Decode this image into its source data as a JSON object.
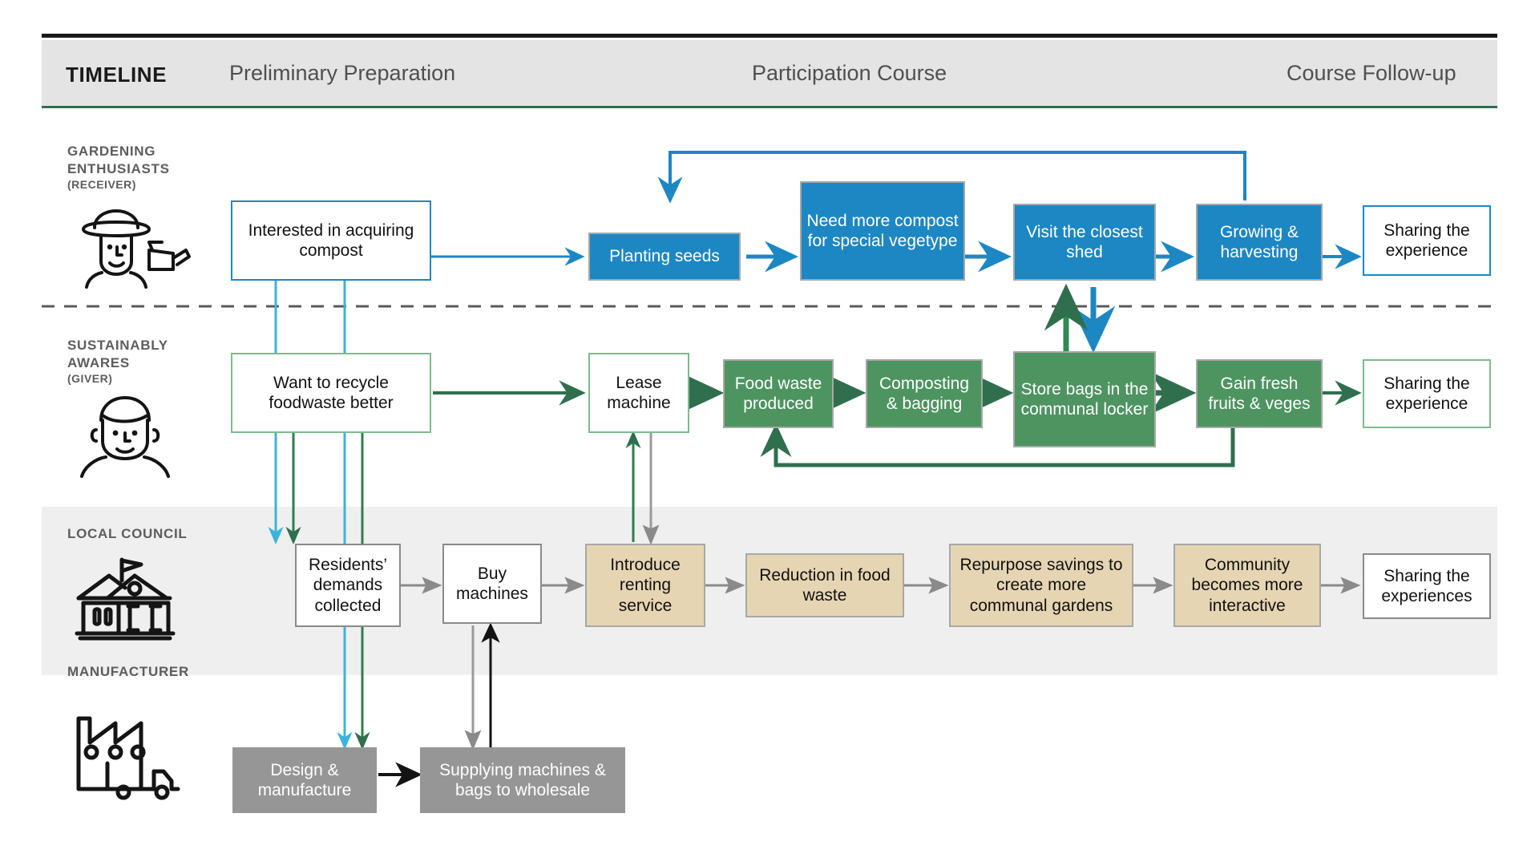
{
  "header": {
    "timeline_label": "TIMELINE",
    "phases": [
      "Preliminary Preparation",
      "Participation Course",
      "Course Follow-up"
    ]
  },
  "lanes": [
    {
      "id": "gardening",
      "title_line1": "GARDENING",
      "title_line2": "ENTHUSIASTS",
      "subtitle": "(RECEIVER)",
      "icon": "gardener-persona-icon"
    },
    {
      "id": "aware",
      "title_line1": "SUSTAINABLY",
      "title_line2": "AWARES",
      "subtitle": "(GIVER)",
      "icon": "person-persona-icon"
    },
    {
      "id": "council",
      "title_line1": "LOCAL COUNCIL",
      "title_line2": "",
      "subtitle": "",
      "icon": "government-building-icon"
    },
    {
      "id": "manufacturer",
      "title_line1": "MANUFACTURER",
      "title_line2": "",
      "subtitle": "",
      "icon": "factory-truck-icon"
    }
  ],
  "nodes": {
    "g1": "Interested in acquiring compost",
    "g2": "Planting seeds",
    "g3": "Need more compost for special vegetype",
    "g4": "Visit the closest shed",
    "g5": "Growing & harvesting",
    "g6": "Sharing the experience",
    "s1": "Want to recycle foodwaste better",
    "s2": "Lease machine",
    "s3": "Food waste produced",
    "s4": "Composting & bagging",
    "s5": "Store bags in the communal locker",
    "s6": "Gain fresh fruits & veges",
    "s7": "Sharing the experience",
    "c1": "Residents’ demands collected",
    "c2": "Buy machines",
    "c3": "Introduce renting service",
    "c4": "Reduction in food waste",
    "c5": "Repurpose savings to create more communal gardens",
    "c6": "Community becomes more interactive",
    "c7": "Sharing the experiences",
    "m1": "Design & manufacture",
    "m2": "Supplying machines & bags to wholesale"
  },
  "colors": {
    "blue": "#1d87c4",
    "green": "#4d9461",
    "green_dark": "#2f6f4e",
    "tan": "#e6d5b2",
    "gray": "#969696",
    "band": "#e4e4e4",
    "council_lane": "#efefef",
    "text_muted": "#5d5d5d"
  }
}
